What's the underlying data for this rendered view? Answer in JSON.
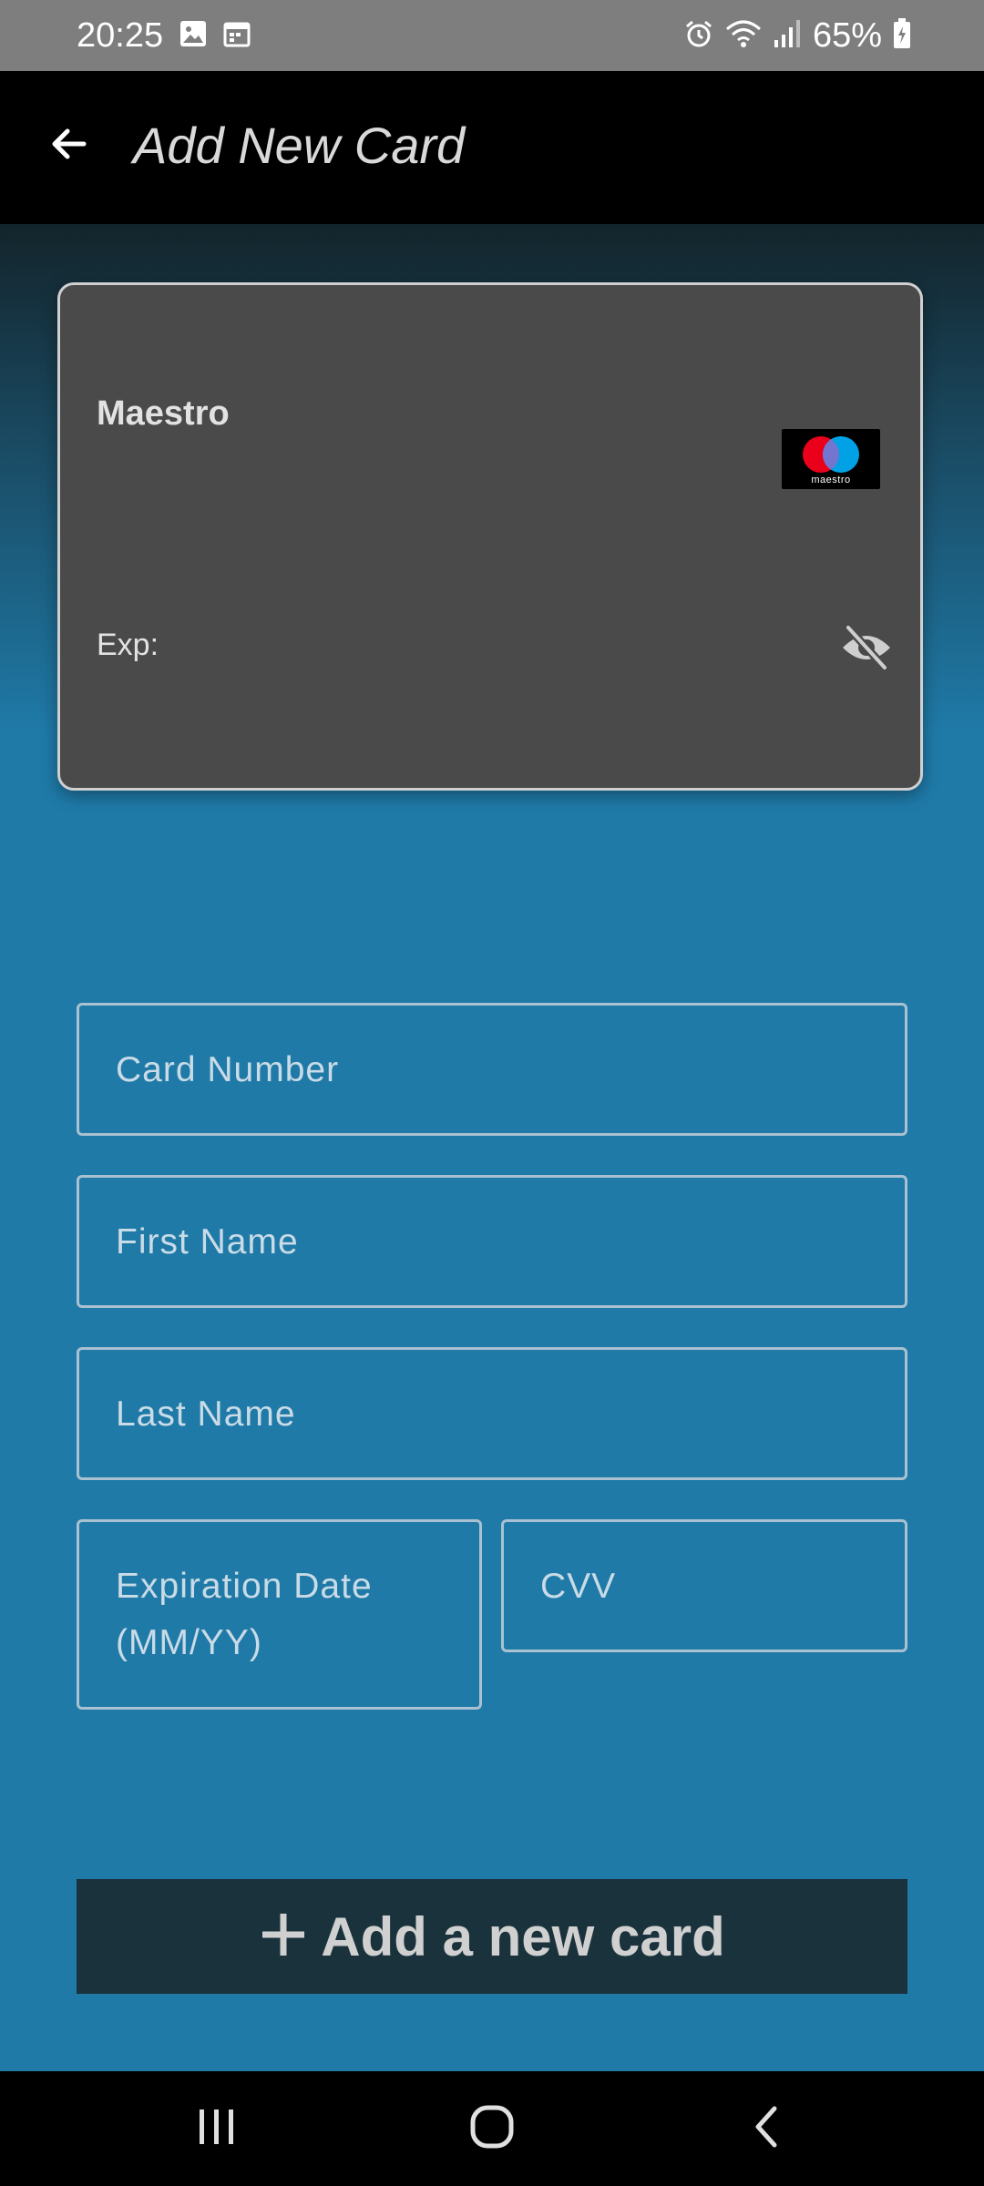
{
  "status_bar": {
    "time": "20:25",
    "battery": "65%",
    "icons": [
      "gallery-icon",
      "calendar-icon",
      "alarm-icon",
      "wifi-icon",
      "signal-icon",
      "battery-icon"
    ]
  },
  "app_bar": {
    "title": "Add New Card",
    "back_icon": "arrow-back-icon"
  },
  "card_preview": {
    "brand_name": "Maestro",
    "logo_text": "maestro",
    "exp_label": "Exp:",
    "visibility_icon": "eye-off-icon"
  },
  "form": {
    "card_number_placeholder": "Card Number",
    "first_name_placeholder": "First Name",
    "last_name_placeholder": "Last Name",
    "expiration_placeholder_line1": "Expiration Date",
    "expiration_placeholder_line2": "(MM/YY)",
    "cvv_placeholder": "CVV"
  },
  "actions": {
    "add_card_label": "Add a new card",
    "add_icon": "plus-icon"
  },
  "nav_bar": {
    "icons": [
      "recents-icon",
      "home-icon",
      "back-icon"
    ]
  },
  "colors": {
    "background": "#1f7aa8",
    "card": "#4a4a4a",
    "button": "#1a323c",
    "field_border": "#a9c1d0",
    "maestro_red": "#eb001b",
    "maestro_blue": "#00a2e5"
  }
}
